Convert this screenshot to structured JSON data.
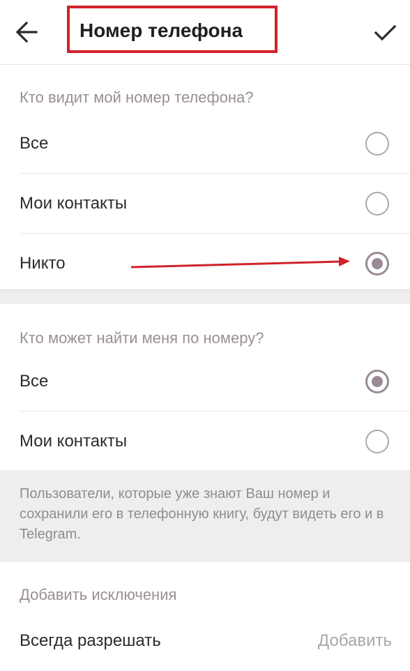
{
  "header": {
    "title": "Номер телефона",
    "back_icon": "arrow-left-icon",
    "done_icon": "check-icon",
    "highlight_color": "#d0222b"
  },
  "who_sees_number": {
    "header": "Кто видит мой номер телефона?",
    "options": [
      {
        "label": "Все",
        "selected": false
      },
      {
        "label": "Мои контакты",
        "selected": false
      },
      {
        "label": "Никто",
        "selected": true
      }
    ]
  },
  "who_finds_by_number": {
    "header": "Кто может найти меня по номеру?",
    "options": [
      {
        "label": "Все",
        "selected": true
      },
      {
        "label": "Мои контакты",
        "selected": false
      }
    ],
    "info": "Пользователи, которые уже знают Ваш номер и сохранили его в телефонную книгу, будут видеть его и в Telegram."
  },
  "exceptions": {
    "header": "Добавить исключения",
    "always_allow_label": "Всегда разрешать",
    "add_label": "Добавить"
  },
  "colors": {
    "accent": "#9a8a95",
    "annotation": "#d0222b"
  }
}
